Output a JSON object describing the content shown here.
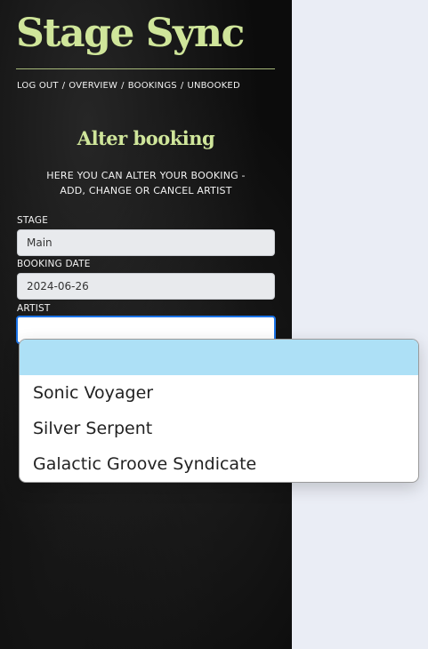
{
  "app": {
    "brand": "Stage Sync"
  },
  "nav": {
    "items": [
      "LOG OUT",
      "OVERVIEW",
      "BOOKINGS",
      "UNBOOKED"
    ],
    "separator": "/"
  },
  "page": {
    "heading": "Alter booking",
    "description_line1": "HERE YOU CAN ALTER YOUR BOOKING -",
    "description_line2": "ADD, CHANGE OR CANCEL ARTIST"
  },
  "form": {
    "stage": {
      "label": "STAGE",
      "value": "Main"
    },
    "booking_date": {
      "label": "BOOKING DATE",
      "value": "2024-06-26"
    },
    "artist": {
      "label": "ARTIST",
      "value": "",
      "options": [
        "",
        "Sonic Voyager",
        "Silver Serpent",
        "Galactic Groove Syndicate"
      ],
      "highlighted_index": 0
    }
  },
  "colors": {
    "brand": "#cfe59a",
    "panel_bg": "#0c0c0c",
    "page_bg": "#eaedf5",
    "focus_ring": "#1a73e8",
    "option_highlight": "#ade0f6"
  }
}
